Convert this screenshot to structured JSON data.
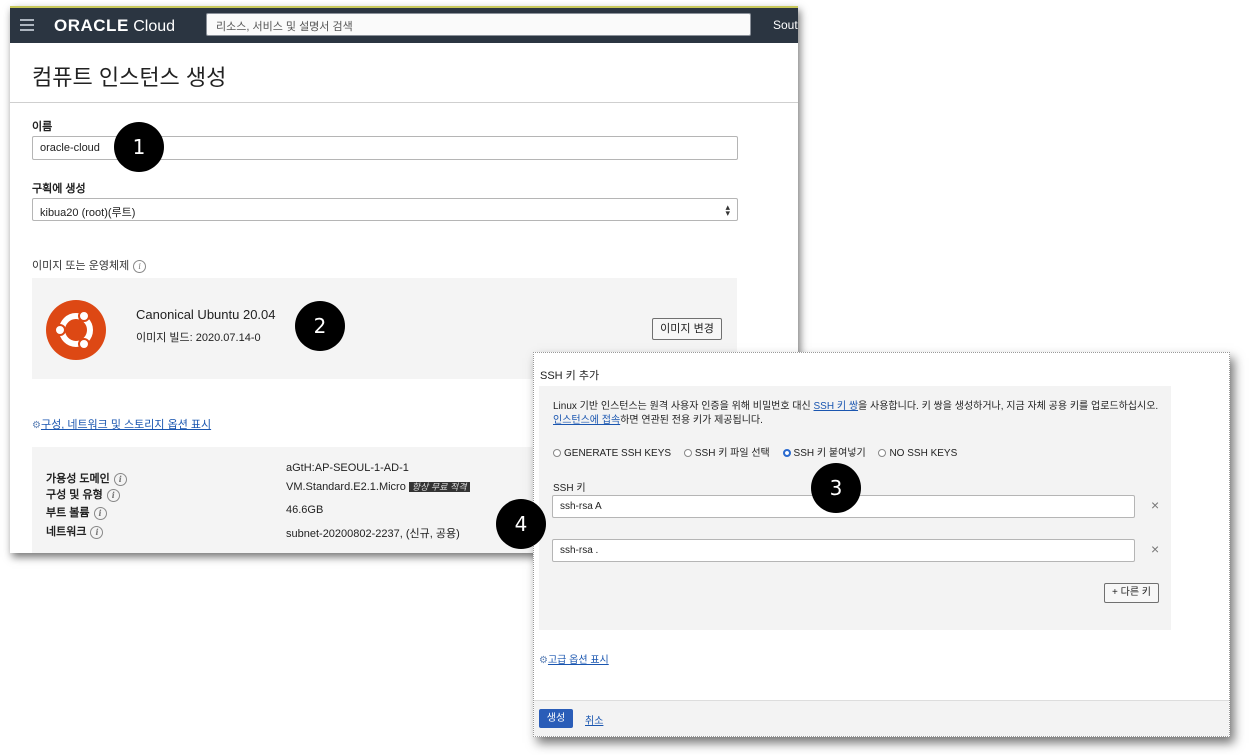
{
  "header": {
    "brand_bold": "ORACLE",
    "brand_light": " Cloud",
    "search_placeholder": "리소스, 서비스 및 설명서 검색",
    "region": "South"
  },
  "page": {
    "title": "컴퓨트 인스턴스 생성"
  },
  "form": {
    "name_label": "이름",
    "name_value": "oracle-cloud",
    "compartment_label": "구획에 생성",
    "compartment_value": "kibua20 (root)(루트)",
    "os_label": "이미지 또는 운영체제",
    "info_glyph": "i"
  },
  "image": {
    "name": "Canonical Ubuntu 20.04",
    "build": "이미지 빌드: 2020.07.14-0",
    "change_button": "이미지 변경"
  },
  "advanced_link": "구성, 네트워크 및 스토리지 옵션 표시",
  "summary": {
    "rows": [
      {
        "key": "가용성 도메인",
        "value": "aGtH:AP-SEOUL-1-AD-1"
      },
      {
        "key": "구성 및 유형",
        "value": "VM.Standard.E2.1.Micro",
        "badge": "항상 무료 적격"
      },
      {
        "key": "부트 볼륨",
        "value": "46.6GB"
      },
      {
        "key": "네트워크",
        "value": "subnet-20200802-2237, (신규, 공용)"
      }
    ]
  },
  "ssh": {
    "title": "SSH 키 추가",
    "desc_prefix": "Linux 기반 인스턴스는 원격 사용자 인증을 위해 비밀번호 대신 ",
    "desc_link1": "SSH 키 쌍",
    "desc_middle": "을 사용합니다. 키 쌍을 생성하거나, 지금 자체 공용 키를 업로드하십시오. ",
    "desc_link2": "인스턴스에 접속",
    "desc_suffix": "하면 연관된 전용 키가 제공됩니다.",
    "options": [
      "GENERATE SSH KEYS",
      "SSH 키 파일 선택",
      "SSH 키 붙여넣기",
      "NO SSH KEYS"
    ],
    "selected_option": "SSH 키 붙여넣기",
    "key_label": "SSH 키",
    "keys": [
      "ssh-rsa A",
      "ssh-rsa ."
    ],
    "remove_glyph": "×",
    "add_key_button": "+ 다른 키",
    "advanced_link": "고급 옵션 표시",
    "create_button": "생성",
    "cancel_link": "취소"
  },
  "callouts": [
    "1",
    "2",
    "3",
    "4"
  ],
  "colors": {
    "topbar": "#2b3541",
    "ubuntu": "#dd4814",
    "link": "#1a56b0",
    "primary_button": "#2a5db8"
  }
}
